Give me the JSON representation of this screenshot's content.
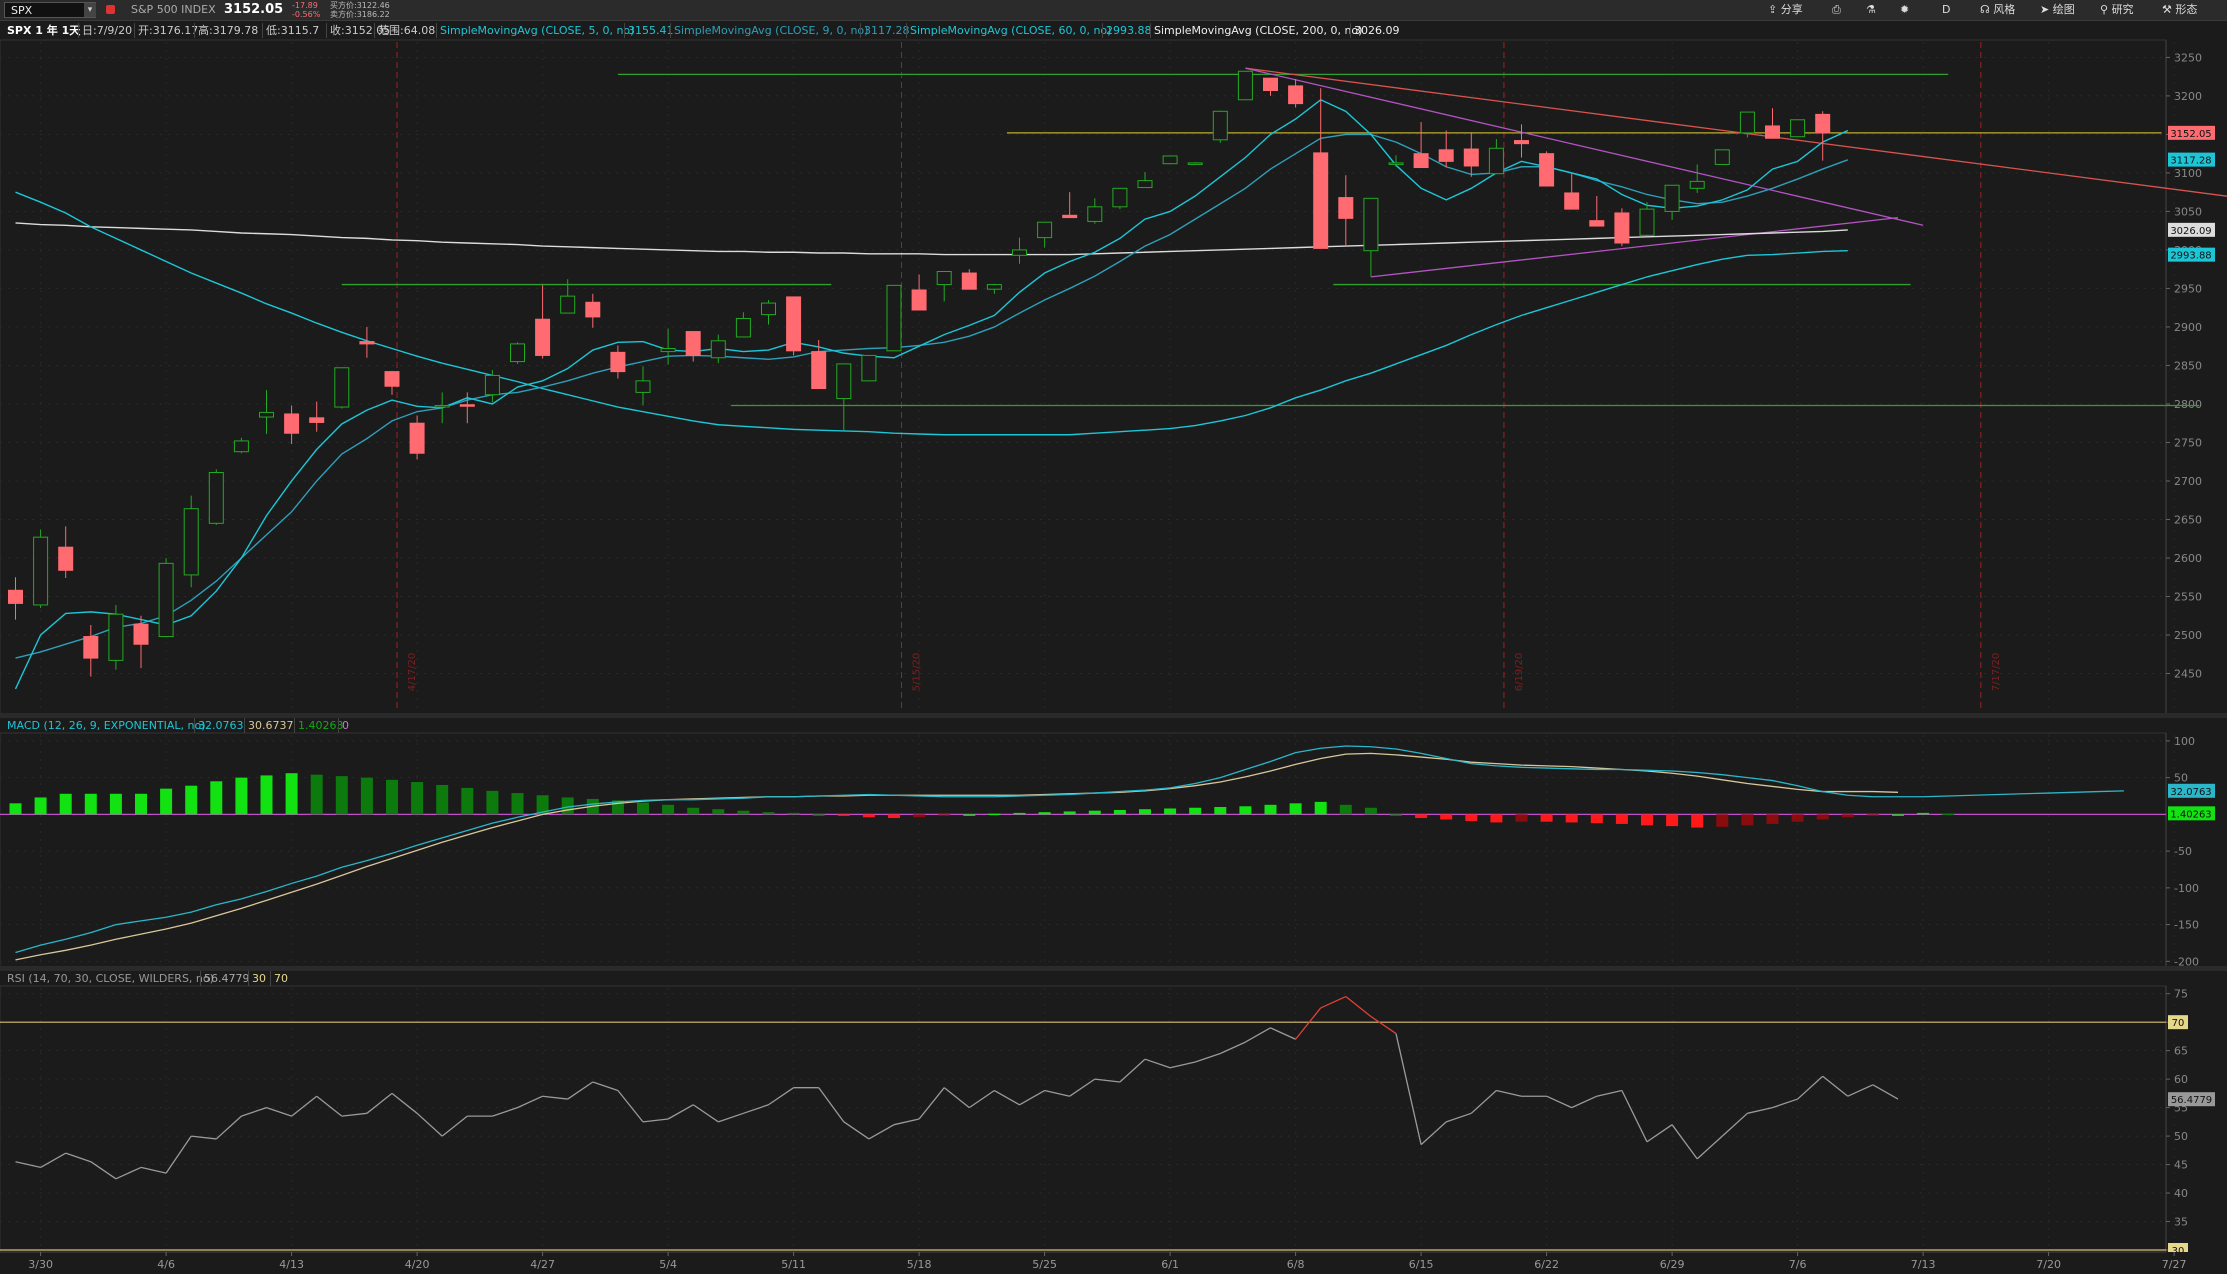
{
  "toolbar": {
    "symbol": "SPX",
    "name": "S&P 500 INDEX",
    "last": "3152.05",
    "change": "-17.89",
    "change_pct": "-0.56%",
    "bid": "买方价:3122.46",
    "ask": "卖方价:3186.22",
    "share_label": "分享",
    "period": "D",
    "style_label": "风格",
    "draw_label": "绘图",
    "study_label": "研究",
    "pattern_label": "形态"
  },
  "info": {
    "period_label": "SPX 1 年 1天",
    "date": "日:7/9/20",
    "open": "开:3176.17",
    "high": "高:3179.78",
    "low": "低:3115.7",
    "close": "收:3152.05",
    "range": "范围:64.08",
    "sma5_label": "SimpleMovingAvg (CLOSE, 5, 0, no)",
    "sma5_val": "3155.41",
    "sma9_label": "SimpleMovingAvg (CLOSE, 9, 0, no)",
    "sma9_val": "3117.28",
    "sma60_label": "SimpleMovingAvg (CLOSE, 60, 0, no)",
    "sma60_val": "2993.88",
    "sma200_label": "SimpleMovingAvg (CLOSE, 200, 0, no)",
    "sma200_val": "3026.09"
  },
  "macd_header": {
    "label": "MACD (12, 26, 9, EXPONENTIAL, no)",
    "v1": "32.0763",
    "v2": "30.6737",
    "v3": "1.40263",
    "v4": "0"
  },
  "rsi_header": {
    "label": "RSI (14, 70, 30, CLOSE, WILDERS, no)",
    "v1": "56.4779",
    "v2": "30",
    "v3": "70"
  },
  "colors": {
    "up": "#22aa22",
    "down": "#ff6b70",
    "bg": "#1b1b1b",
    "sma5": "#1cc6d6",
    "sma9": "#2e9fb8",
    "sma200": "#dcdcdc",
    "macd": "#2ab7c9",
    "signal": "#d8c79a",
    "rsi": "#9a9a9a",
    "hist_up": "#12e212",
    "hist_up_dark": "#0d7a0d",
    "hist_down": "#ff1a1a",
    "hist_down_dark": "#8a0d0d"
  },
  "chart_data": [
    {
      "type": "candlestick",
      "ylim": [
        2400,
        3270
      ],
      "y_ticks": [
        2450,
        2500,
        2550,
        2600,
        2650,
        2700,
        2750,
        2800,
        2850,
        2900,
        2950,
        3000,
        3050,
        3100,
        3150,
        3200,
        3250
      ],
      "x_tick_labels": [
        "3/30",
        "4/6",
        "4/13",
        "4/20",
        "4/27",
        "5/4",
        "5/11",
        "5/18",
        "5/25",
        "6/1",
        "6/8",
        "6/15",
        "6/22",
        "6/29",
        "7/6",
        "7/13",
        "7/20",
        "7/27"
      ],
      "x_tick_index": [
        1,
        6,
        11,
        16,
        21,
        26,
        31,
        36,
        41,
        46,
        51,
        56,
        61,
        66,
        71,
        76,
        81,
        86
      ],
      "date_markers": [
        {
          "i": 15.2,
          "label": "4/17/20"
        },
        {
          "i": 35.3,
          "label": "5/15/20"
        },
        {
          "i": 59.3,
          "label": "6/19/20"
        },
        {
          "i": 78.3,
          "label": "7/17/20"
        }
      ],
      "candles": [
        [
          2558,
          2575,
          2520,
          2541
        ],
        [
          2539,
          2637,
          2535,
          2627
        ],
        [
          2614,
          2641,
          2574,
          2584
        ],
        [
          2498,
          2513,
          2446,
          2470
        ],
        [
          2467,
          2539,
          2455,
          2527
        ],
        [
          2514,
          2525,
          2457,
          2488
        ],
        [
          2498,
          2600,
          2497,
          2593
        ],
        [
          2578,
          2681,
          2562,
          2664
        ],
        [
          2645,
          2715,
          2643,
          2711
        ],
        [
          2738,
          2756,
          2736,
          2752
        ],
        [
          2783,
          2818,
          2761,
          2789
        ],
        [
          2787,
          2798,
          2748,
          2762
        ],
        [
          2782,
          2803,
          2764,
          2776
        ],
        [
          2796,
          2845,
          2794,
          2847
        ],
        [
          2881,
          2900,
          2860,
          2878
        ],
        [
          2842,
          2843,
          2812,
          2823
        ],
        [
          2775,
          2785,
          2728,
          2736
        ],
        [
          2797,
          2815,
          2775,
          2798
        ],
        [
          2799,
          2815,
          2775,
          2797
        ],
        [
          2812,
          2844,
          2802,
          2837
        ],
        [
          2855,
          2880,
          2852,
          2878
        ],
        [
          2910,
          2954,
          2859,
          2863
        ],
        [
          2918,
          2962,
          2925,
          2940
        ],
        [
          2932,
          2943,
          2899,
          2913
        ],
        [
          2867,
          2876,
          2833,
          2842
        ],
        [
          2815,
          2849,
          2798,
          2830
        ],
        [
          2868,
          2898,
          2851,
          2872
        ],
        [
          2894,
          2891,
          2855,
          2863
        ],
        [
          2860,
          2890,
          2853,
          2882
        ],
        [
          2887,
          2919,
          2892,
          2911
        ],
        [
          2916,
          2935,
          2903,
          2931
        ],
        [
          2939,
          2936,
          2863,
          2869
        ],
        [
          2868,
          2883,
          2863,
          2820
        ],
        [
          2807,
          2813,
          2766,
          2852
        ],
        [
          2830,
          2855,
          2834,
          2863
        ],
        [
          2869,
          2934,
          2869,
          2954
        ],
        [
          2948,
          2968,
          2938,
          2922
        ],
        [
          2955,
          2957,
          2933,
          2972
        ],
        [
          2970,
          2975,
          2950,
          2949
        ],
        [
          2949,
          2956,
          2943,
          2955
        ],
        [
          2993,
          3016,
          2982,
          3000
        ],
        [
          3016,
          3031,
          3003,
          3036
        ],
        [
          3045,
          3075,
          3044,
          3042
        ],
        [
          3037,
          3067,
          3034,
          3056
        ],
        [
          3056,
          3076,
          3053,
          3080
        ],
        [
          3081,
          3101,
          3081,
          3090
        ],
        [
          3112,
          3121,
          3111,
          3122
        ],
        [
          3113,
          3114,
          3114,
          3113
        ],
        [
          3143,
          3181,
          3139,
          3180
        ],
        [
          3195,
          3227,
          3205,
          3232
        ],
        [
          3223,
          3221,
          3200,
          3207
        ],
        [
          3213,
          3222,
          3185,
          3190
        ],
        [
          3126,
          3210,
          3114,
          3002
        ],
        [
          3068,
          3097,
          3005,
          3041
        ],
        [
          2999,
          3063,
          2965,
          3067
        ],
        [
          3112,
          3123,
          3108,
          3113
        ],
        [
          3125,
          3166,
          3110,
          3107
        ],
        [
          3130,
          3155,
          3107,
          3115
        ],
        [
          3131,
          3153,
          3095,
          3109
        ],
        [
          3099,
          3144,
          3117,
          3132
        ],
        [
          3142,
          3163,
          3120,
          3138
        ],
        [
          3125,
          3128,
          3130,
          3083
        ],
        [
          3074,
          3099,
          3053,
          3053
        ],
        [
          3038,
          3070,
          3048,
          3031
        ],
        [
          3048,
          3054,
          3005,
          3009
        ],
        [
          3019,
          3062,
          3018,
          3053
        ],
        [
          3050,
          3081,
          3039,
          3084
        ],
        [
          3080,
          3111,
          3074,
          3089
        ],
        [
          3111,
          3112,
          3133,
          3130
        ],
        [
          3152,
          3150,
          3146,
          3179
        ],
        [
          3161,
          3184,
          3150,
          3145
        ],
        [
          3147,
          3168,
          3160,
          3169
        ],
        [
          3176,
          3180,
          3116,
          3152
        ]
      ],
      "sma5": [
        2430,
        2500,
        2528,
        2530,
        2527,
        2520,
        2513,
        2525,
        2557,
        2600,
        2655,
        2700,
        2741,
        2774,
        2792,
        2805,
        2797,
        2795,
        2808,
        2800,
        2822,
        2830,
        2846,
        2870,
        2880,
        2881,
        2870,
        2868,
        2872,
        2868,
        2870,
        2880,
        2874,
        2866,
        2862,
        2860,
        2875,
        2890,
        2902,
        2915,
        2945,
        2970,
        2985,
        2997,
        3015,
        3040,
        3050,
        3070,
        3095,
        3120,
        3150,
        3170,
        3195,
        3180,
        3150,
        3110,
        3080,
        3065,
        3080,
        3100,
        3115,
        3108,
        3100,
        3092,
        3072,
        3058,
        3054,
        3057,
        3065,
        3078,
        3105,
        3115,
        3140,
        3155
      ],
      "sma9": [
        2470,
        2478,
        2488,
        2498,
        2510,
        2515,
        2525,
        2545,
        2570,
        2600,
        2630,
        2660,
        2700,
        2735,
        2755,
        2778,
        2790,
        2795,
        2805,
        2812,
        2815,
        2822,
        2830,
        2840,
        2848,
        2855,
        2862,
        2863,
        2862,
        2860,
        2858,
        2861,
        2868,
        2870,
        2872,
        2873,
        2876,
        2880,
        2888,
        2900,
        2918,
        2935,
        2950,
        2966,
        2985,
        3005,
        3020,
        3040,
        3060,
        3080,
        3105,
        3125,
        3145,
        3150,
        3150,
        3140,
        3125,
        3108,
        3098,
        3100,
        3108,
        3108,
        3100,
        3090,
        3082,
        3072,
        3065,
        3060,
        3062,
        3070,
        3080,
        3092,
        3105,
        3117
      ],
      "sma60": [
        3075,
        3062,
        3048,
        3030,
        3015,
        3000,
        2985,
        2970,
        2957,
        2944,
        2930,
        2918,
        2905,
        2893,
        2882,
        2872,
        2862,
        2853,
        2845,
        2837,
        2829,
        2820,
        2812,
        2804,
        2796,
        2790,
        2784,
        2778,
        2773,
        2771,
        2769,
        2767,
        2766,
        2765,
        2764,
        2762,
        2761,
        2760,
        2760,
        2760,
        2760,
        2760,
        2760,
        2762,
        2764,
        2766,
        2768,
        2772,
        2778,
        2785,
        2795,
        2808,
        2818,
        2830,
        2840,
        2852,
        2864,
        2876,
        2890,
        2903,
        2915,
        2925,
        2935,
        2945,
        2955,
        2965,
        2973,
        2981,
        2988,
        2993,
        2994,
        2996,
        2998,
        2999
      ],
      "sma200": [
        3035,
        3033,
        3032,
        3030,
        3029,
        3028,
        3027,
        3026,
        3024,
        3022,
        3021,
        3020,
        3018,
        3016,
        3015,
        3013,
        3012,
        3010,
        3009,
        3008,
        3007,
        3005,
        3004,
        3003,
        3002,
        3001,
        3000,
        2999,
        2998,
        2998,
        2997,
        2997,
        2996,
        2996,
        2995,
        2995,
        2995,
        2994,
        2994,
        2994,
        2994,
        2994,
        2994,
        2995,
        2996,
        2997,
        2998,
        2999,
        3000,
        3001,
        3002,
        3003,
        3004,
        3005,
        3006,
        3007,
        3008,
        3009,
        3010,
        3011,
        3012,
        3013,
        3014,
        3015,
        3016,
        3017,
        3018,
        3019,
        3020,
        3021,
        3022,
        3023,
        3024,
        3026
      ],
      "hlines": [
        {
          "y": 3228,
          "i0": 24,
          "i1": 77,
          "color": "#2fa02f"
        },
        {
          "y": 3152,
          "i0": 39.5,
          "i1": 85.5,
          "color": "#bcae2a"
        },
        {
          "y": 2955,
          "i0": 13,
          "i1": 32.5,
          "color": "#2fa02f"
        },
        {
          "y": 2955,
          "i0": 52.5,
          "i1": 75.5,
          "color": "#2fa02f"
        },
        {
          "y": 2798,
          "i0": 28.5,
          "i1": 87,
          "color": "#2fa02f"
        }
      ],
      "trendlines": [
        {
          "i0": 49,
          "y0": 3236,
          "i1": 89,
          "y1": 3066,
          "color": "#d9534f"
        },
        {
          "i0": 49,
          "y0": 3236,
          "i1": 76,
          "y1": 3032,
          "color": "#b354c2"
        },
        {
          "i0": 54,
          "y0": 2965,
          "i1": 75,
          "y1": 3042,
          "color": "#b354c2"
        }
      ],
      "last_labels": [
        {
          "y": 3152.05,
          "text": "3152.05",
          "bg": "#ff6b70"
        },
        {
          "y": 3117.28,
          "text": "3117.28",
          "bg": "#1cc6d6"
        },
        {
          "y": 3026.09,
          "text": "3026.09",
          "bg": "#dcdcdc"
        },
        {
          "y": 2993.88,
          "text": "2993.88",
          "bg": "#1cc6d6"
        }
      ]
    },
    {
      "type": "bar",
      "ylim": [
        -205,
        108
      ],
      "y_ticks": [
        100,
        50,
        -50,
        -100,
        -150,
        -200
      ],
      "hist": [
        15,
        23,
        28,
        28,
        28,
        28,
        35,
        39,
        45,
        50,
        53,
        56,
        54,
        52,
        50,
        47,
        44,
        40,
        36,
        32,
        29,
        26,
        23,
        21,
        19,
        16,
        13,
        9,
        7,
        5,
        3,
        2,
        0,
        -2,
        -4,
        -5,
        -4,
        -2,
        0,
        1,
        2,
        3,
        4,
        5,
        6,
        7,
        8,
        9,
        10,
        11,
        13,
        15,
        17,
        13,
        9,
        0,
        -5,
        -7,
        -9,
        -11,
        -10,
        -10,
        -11,
        -12,
        -13,
        -15,
        -16,
        -18,
        -17,
        -15,
        -13,
        -10,
        -7,
        -4,
        -2,
        0,
        2,
        1
      ],
      "macd": [
        -188,
        -178,
        -170,
        -161,
        -150,
        -145,
        -140,
        -133,
        -123,
        -115,
        -105,
        -94,
        -84,
        -72,
        -63,
        -53,
        -42,
        -32,
        -22,
        -12,
        -4,
        3,
        10,
        14,
        17,
        19,
        20,
        20,
        21,
        22,
        24,
        24,
        25,
        26,
        27,
        26,
        25,
        24,
        24,
        24,
        25,
        26,
        27,
        29,
        31,
        33,
        36,
        42,
        50,
        61,
        72,
        84,
        90,
        93,
        92,
        89,
        83,
        76,
        69,
        66,
        64,
        63,
        62,
        61,
        61,
        60,
        59,
        57,
        54,
        50,
        46,
        39,
        31,
        26,
        24,
        24,
        24,
        25,
        26,
        27,
        28,
        29,
        30,
        31,
        32
      ],
      "signal": [
        -198,
        -191,
        -185,
        -178,
        -170,
        -163,
        -156,
        -148,
        -138,
        -128,
        -117,
        -106,
        -95,
        -83,
        -71,
        -60,
        -49,
        -38,
        -28,
        -18,
        -9,
        0,
        6,
        11,
        15,
        18,
        20,
        21,
        22,
        23,
        24,
        24,
        25,
        25,
        26,
        26,
        26,
        26,
        26,
        26,
        26,
        27,
        28,
        29,
        30,
        32,
        35,
        39,
        44,
        51,
        59,
        68,
        76,
        82,
        83,
        81,
        78,
        75,
        71,
        69,
        67,
        66,
        65,
        63,
        61,
        59,
        56,
        52,
        47,
        42,
        38,
        34,
        31,
        31,
        31,
        30
      ]
    },
    {
      "type": "line",
      "ylim": [
        30,
        76
      ],
      "y_ticks": [
        75,
        70,
        65,
        60,
        55,
        50,
        45,
        40,
        35,
        30
      ],
      "levels": [
        70,
        30
      ],
      "rsi": [
        45.5,
        44.5,
        47,
        45.5,
        42.5,
        44.5,
        43.5,
        50,
        49.5,
        53.5,
        55,
        53.5,
        57,
        53.5,
        54,
        57.5,
        54,
        50,
        53.5,
        53.5,
        55,
        57,
        56.5,
        59.5,
        58,
        52.5,
        53,
        55.5,
        52.5,
        54,
        55.5,
        58.5,
        58.5,
        52.5,
        49.5,
        52,
        53,
        58.5,
        55,
        58,
        55.5,
        58,
        57,
        60,
        59.5,
        63.5,
        62,
        63,
        64.5,
        66.5,
        69,
        67,
        72.5,
        74.5,
        71,
        68,
        48.5,
        52.5,
        54,
        58,
        57,
        57,
        55,
        57,
        58,
        49,
        52,
        46,
        50,
        54,
        55,
        56.5,
        60.5,
        57,
        59,
        56.5
      ],
      "rsi_x_extend": 0
    }
  ]
}
